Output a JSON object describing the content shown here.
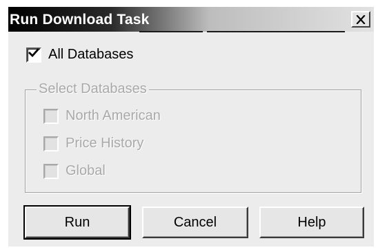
{
  "window": {
    "title": "Run Download Task",
    "close_glyph": "close-icon"
  },
  "all_databases": {
    "label": "All Databases",
    "checked": true
  },
  "select_databases": {
    "group_label": "Select Databases",
    "enabled": false,
    "items": [
      {
        "label": "North American",
        "checked": false
      },
      {
        "label": "Price History",
        "checked": false
      },
      {
        "label": "Global",
        "checked": false
      }
    ]
  },
  "buttons": {
    "run": "Run",
    "cancel": "Cancel",
    "help": "Help"
  },
  "colors": {
    "dialog_face": "#ececec",
    "disabled_text": "#a9a9a9",
    "title_start": "#000000",
    "title_end": "#e2e2e2"
  }
}
